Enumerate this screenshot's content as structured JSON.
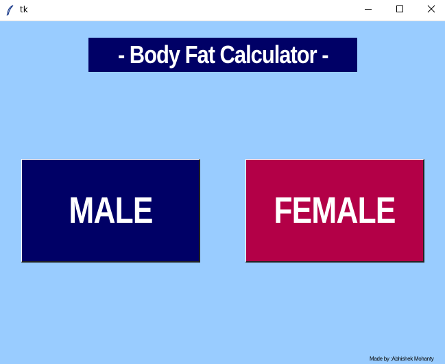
{
  "window": {
    "title": "tk",
    "background": "#99ccff",
    "controls": {
      "minimize_icon": "minimize-icon",
      "maximize_icon": "maximize-icon",
      "close_icon": "close-icon"
    }
  },
  "header": {
    "title": "- Body Fat Calculator -",
    "background": "#000066"
  },
  "buttons": {
    "male": {
      "label": "MALE",
      "color": "#000066"
    },
    "female": {
      "label": "FEMALE",
      "color": "#b30047"
    }
  },
  "footer": {
    "credit": "Made by :Abhishek Mohanty"
  }
}
